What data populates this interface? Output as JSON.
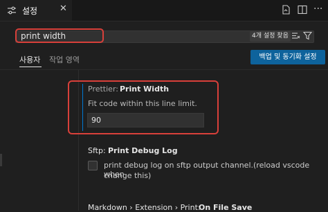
{
  "tab": {
    "title": "설정",
    "icon": "settings-sliders-icon",
    "close": "✕"
  },
  "search": {
    "value": "print width",
    "count_label": "4개 설정 찾음"
  },
  "scopes": {
    "user": "사용자",
    "workspace": "작업 영역",
    "sync_button": "백업 및 동기화 설정"
  },
  "settings": [
    {
      "category": "Prettier: ",
      "name": "Print Width",
      "description": "Fit code within this line limit.",
      "value": "90"
    },
    {
      "category": "Sftp: ",
      "name": "Print Debug Log",
      "description_line1": "print debug log on sftp output channel.(reload vscode when",
      "description_line2": "change this)"
    },
    {
      "category": "Markdown › Extension › Print: ",
      "name": "On File Save"
    }
  ],
  "colors": {
    "accent": "#0078d4",
    "highlight": "#d9403a",
    "button": "#0e639c"
  }
}
